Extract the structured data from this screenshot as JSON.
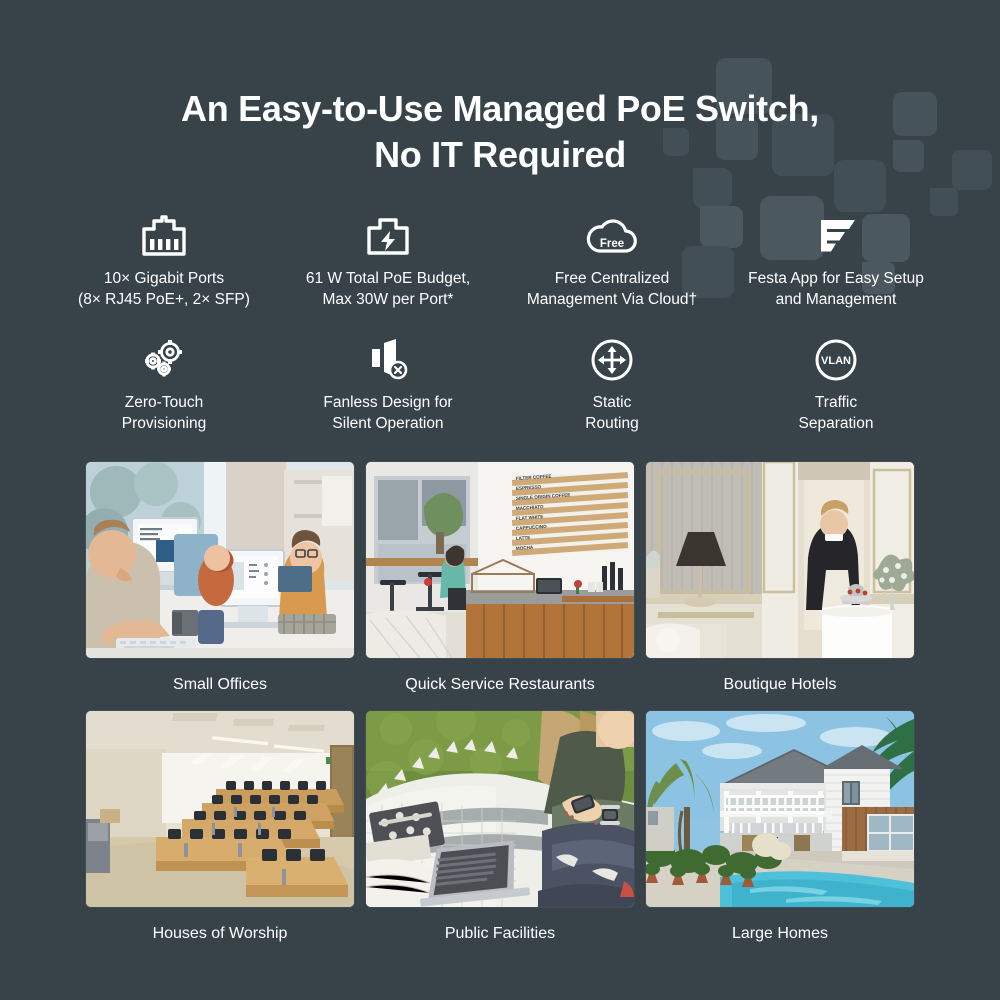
{
  "theme": {
    "background": "#374349",
    "pattern_color": "#4a565c",
    "text_color": "#ffffff"
  },
  "headline": {
    "line1": "An Easy-to-Use Managed PoE Switch,",
    "line2": "No IT Required"
  },
  "features": [
    {
      "icon": "rj45-port-icon",
      "label": "10× Gigabit Ports\n(8× RJ45 PoE+, 2× SFP)"
    },
    {
      "icon": "poe-battery-bolt-icon",
      "label": "61 W Total PoE Budget,\nMax 30W per Port*"
    },
    {
      "icon": "free-cloud-icon",
      "label": "Free Centralized\nManagement Via Cloud†"
    },
    {
      "icon": "festa-logo-icon",
      "label": "Festa App for Easy Setup\nand Management"
    },
    {
      "icon": "gears-icon",
      "label": "Zero-Touch\nProvisioning"
    },
    {
      "icon": "speaker-mute-icon",
      "label": "Fanless Design for\nSilent Operation"
    },
    {
      "icon": "static-routing-arrows-icon",
      "label": "Static\nRouting"
    },
    {
      "icon": "vlan-circle-icon",
      "label": "Traffic\nSeparation"
    }
  ],
  "scenarios": [
    {
      "caption": "Small Offices",
      "image": "office-workers-at-computers"
    },
    {
      "caption": "Quick Service Restaurants",
      "image": "cafe-counter-with-menu-board"
    },
    {
      "caption": "Boutique Hotels",
      "image": "hotel-room-service-attendant"
    },
    {
      "caption": "Houses of Worship",
      "image": "lecture-hall-tiered-seating"
    },
    {
      "caption": "Public Facilities",
      "image": "person-outdoors-with-laptop"
    },
    {
      "caption": "Large Homes",
      "image": "white-house-with-pool"
    }
  ]
}
